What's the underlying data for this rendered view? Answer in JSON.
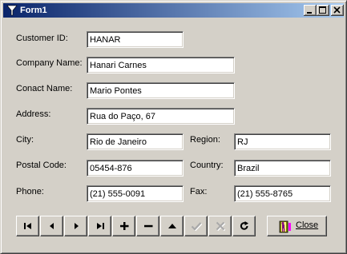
{
  "window": {
    "title": "Form1",
    "controls": {
      "minimize": "minimize",
      "maximize": "maximize",
      "close": "close"
    }
  },
  "form": {
    "customer_id": {
      "label": "Customer ID:",
      "value": "HANAR"
    },
    "company_name": {
      "label": "Company Name:",
      "value": "Hanari Carnes"
    },
    "contact_name": {
      "label": "Conact Name:",
      "value": "Mario Pontes"
    },
    "address": {
      "label": "Address:",
      "value": "Rua do Paço, 67"
    },
    "city": {
      "label": "City:",
      "value": "Rio de Janeiro"
    },
    "region": {
      "label": "Region:",
      "value": "RJ"
    },
    "postal_code": {
      "label": "Postal Code:",
      "value": "05454-876"
    },
    "country": {
      "label": "Country:",
      "value": "Brazil"
    },
    "phone": {
      "label": "Phone:",
      "value": "(21) 555-0091"
    },
    "fax": {
      "label": "Fax:",
      "value": "(21) 555-8765"
    }
  },
  "navigator": {
    "buttons": [
      {
        "icon": "first-record-icon",
        "enabled": true
      },
      {
        "icon": "prior-record-icon",
        "enabled": true
      },
      {
        "icon": "next-record-icon",
        "enabled": true
      },
      {
        "icon": "last-record-icon",
        "enabled": true
      },
      {
        "icon": "insert-record-icon",
        "enabled": true
      },
      {
        "icon": "delete-record-icon",
        "enabled": true
      },
      {
        "icon": "edit-record-icon",
        "enabled": true
      },
      {
        "icon": "post-edit-icon",
        "enabled": false
      },
      {
        "icon": "cancel-edit-icon",
        "enabled": false
      },
      {
        "icon": "refresh-data-icon",
        "enabled": true
      }
    ]
  },
  "close_button": {
    "label": "Close",
    "icon": "door-exit-icon"
  },
  "colors": {
    "titlebar_start": "#0a246a",
    "titlebar_end": "#a6caf0",
    "face": "#d4d0c8"
  }
}
